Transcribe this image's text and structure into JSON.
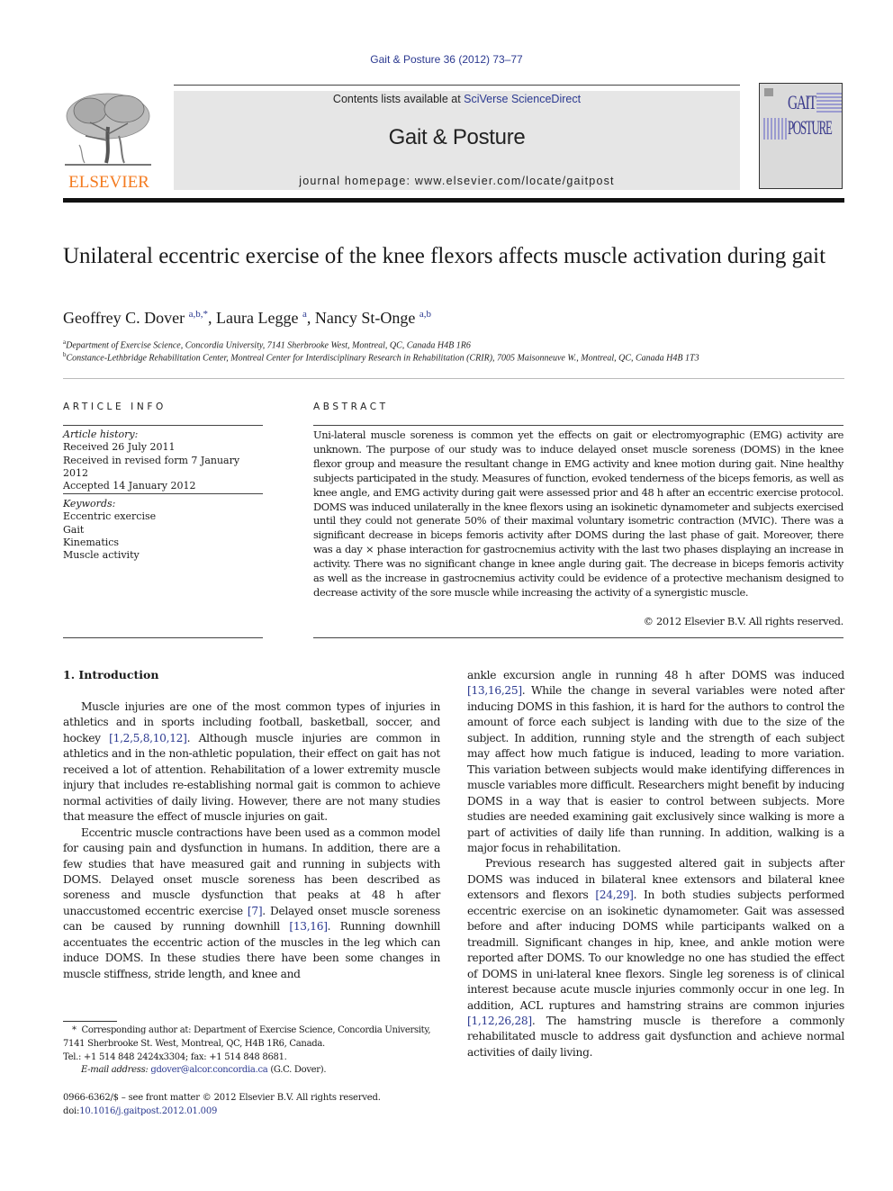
{
  "citation": "Gait & Posture 36 (2012) 73–77",
  "masthead": {
    "contents_prefix": "Contents lists available at ",
    "contents_link": "SciVerse ScienceDirect",
    "journal_title": "Gait & Posture",
    "homepage": "journal homepage: www.elsevier.com/locate/gaitpost",
    "publisher_logo_text": "ELSEVIER",
    "cover_line1": "GAIT",
    "cover_line2": "POSTURE"
  },
  "article": {
    "title": "Unilateral eccentric exercise of the knee flexors affects muscle activation during gait",
    "authors": [
      {
        "name": "Geoffrey C. Dover",
        "sup": "a,b,*",
        "sep": ", "
      },
      {
        "name": "Laura Legge",
        "sup": "a",
        "sep": ", "
      },
      {
        "name": "Nancy St-Onge",
        "sup": "a,b",
        "sep": ""
      }
    ],
    "affiliations": [
      {
        "mark": "a",
        "text": "Department of Exercise Science, Concordia University, 7141 Sherbrooke West, Montreal, QC, Canada H4B 1R6"
      },
      {
        "mark": "b",
        "text": "Constance-Lethbridge Rehabilitation Center, Montreal Center for Interdisciplinary Research in Rehabilitation (CRIR), 7005 Maisonneuve W., Montreal, QC, Canada H4B 1T3"
      }
    ]
  },
  "article_info": {
    "heading": "ARTICLE INFO",
    "history_label": "Article history:",
    "history": [
      "Received 26 July 2011",
      "Received in revised form 7 January 2012",
      "Accepted 14 January 2012"
    ],
    "keywords_label": "Keywords:",
    "keywords": [
      "Eccentric exercise",
      "Gait",
      "Kinematics",
      "Muscle activity"
    ]
  },
  "abstract": {
    "heading": "ABSTRACT",
    "text": "Uni-lateral muscle soreness is common yet the effects on gait or electromyographic (EMG) activity are unknown. The purpose of our study was to induce delayed onset muscle soreness (DOMS) in the knee flexor group and measure the resultant change in EMG activity and knee motion during gait. Nine healthy subjects participated in the study. Measures of function, evoked tenderness of the biceps femoris, as well as knee angle, and EMG activity during gait were assessed prior and 48 h after an eccentric exercise protocol. DOMS was induced unilaterally in the knee flexors using an isokinetic dynamometer and subjects exercised until they could not generate 50% of their maximal voluntary isometric contraction (MVIC). There was a significant decrease in biceps femoris activity after DOMS during the last phase of gait. Moreover, there was a day × phase interaction for gastrocnemius activity with the last two phases displaying an increase in activity. There was no significant change in knee angle during gait. The decrease in biceps femoris activity as well as the increase in gastrocnemius activity could be evidence of a protective mechanism designed to decrease activity of the sore muscle while increasing the activity of a synergistic muscle.",
    "copyright": "© 2012 Elsevier B.V. All rights reserved."
  },
  "introduction": {
    "heading": "1.  Introduction",
    "p1_a": "Muscle injuries are one of the most common types of injuries in athletics and in sports including football, basketball, soccer, and hockey ",
    "p1_ref": "[1,2,5,8,10,12]",
    "p1_b": ". Although muscle injuries are common in athletics and in the non-athletic population, their effect on gait has not received a lot of attention. Rehabilitation of a lower extremity muscle injury that includes re-establishing normal gait is common to achieve normal activities of daily living. However, there are not many studies that measure the effect of muscle injuries on gait.",
    "p2_a": "Eccentric muscle contractions have been used as a common model for causing pain and dysfunction in humans. In addition, there are a few studies that have measured gait and running in subjects with DOMS. Delayed onset muscle soreness has been described as soreness and muscle dysfunction that peaks at 48 h after unaccustomed eccentric exercise ",
    "p2_ref1": "[7]",
    "p2_b": ". Delayed onset muscle soreness can be caused by running downhill ",
    "p2_ref2": "[13,16]",
    "p2_c": ". Running downhill accentuates the eccentric action of the muscles in the leg which can induce DOMS. In these studies there have been some changes in muscle stiffness, stride length, and knee and",
    "p3_a": "ankle excursion angle in running 48 h after DOMS was induced ",
    "p3_ref": "[13,16,25]",
    "p3_b": ". While the change in several variables were noted after inducing DOMS in this fashion, it is hard for the authors to control the amount of force each subject is landing with due to the size of the subject. In addition, running style and the strength of each subject may affect how much fatigue is induced, leading to more variation. This variation between subjects would make identifying differences in muscle variables more difficult. Researchers might benefit by inducing DOMS in a way that is easier to control between subjects. More studies are needed examining gait exclusively since walking is more a part of activities of daily life than running. In addition, walking is a major focus in rehabilitation.",
    "p4_a": "Previous research has suggested altered gait in subjects after DOMS was induced in bilateral knee extensors and bilateral knee extensors and flexors ",
    "p4_ref1": "[24,29]",
    "p4_b": ". In both studies subjects performed eccentric exercise on an isokinetic dynamometer. Gait was assessed before and after inducing DOMS while participants walked on a treadmill. Significant changes in hip, knee, and ankle motion were reported after DOMS. To our knowledge no one has studied the effect of DOMS in uni-lateral knee flexors. Single leg soreness is of clinical interest because acute muscle injuries commonly occur in one leg. In addition, ACL ruptures and hamstring strains are common injuries ",
    "p4_ref2": "[1,12,26,28]",
    "p4_c": ". The hamstring muscle is therefore a commonly rehabilitated muscle to address gait dysfunction and achieve normal activities of daily living."
  },
  "footnotes": {
    "corresponding_mark": "*",
    "corresponding": "Corresponding author at: Department of Exercise Science, Concordia University, 7141 Sherbrooke St. West, Montreal, QC, H4B 1R6, Canada.",
    "tel": "Tel.: +1 514 848 2424x3304; fax: +1 514 848 8681.",
    "email_label": "E-mail address: ",
    "email": "gdover@alcor.concordia.ca",
    "email_suffix": " (G.C. Dover).",
    "front_matter": "0966-6362/$ – see front matter © 2012 Elsevier B.V. All rights reserved.",
    "doi_label": "doi:",
    "doi": "10.1016/j.gaitpost.2012.01.009"
  },
  "colors": {
    "link": "#2b3990",
    "elsevier_orange": "#f47b20",
    "masthead_bg": "#e6e6e6"
  }
}
